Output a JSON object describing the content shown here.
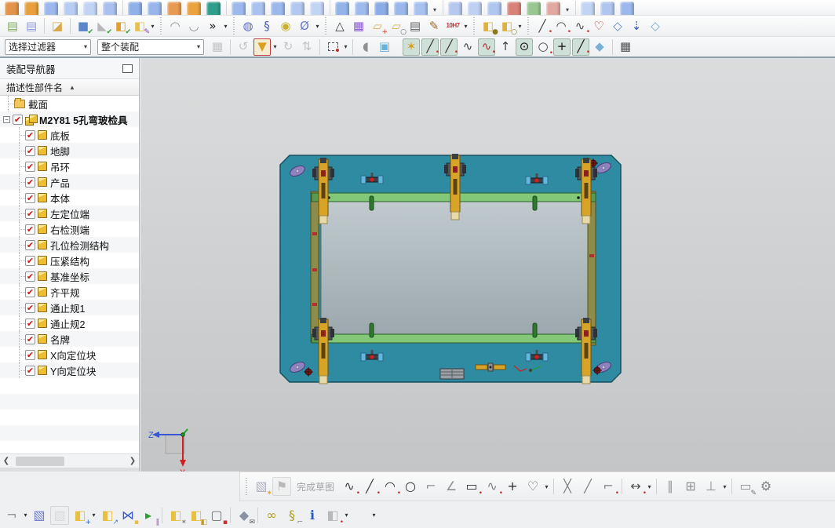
{
  "theme": {
    "plate": "#2f8ba2",
    "plate-dark": "#17505f",
    "glass-a": "#bcc6ca",
    "glass-b": "#9ca8ad",
    "bar": "#82c878",
    "bar-dark": "#2e5c2a",
    "rail": "#8e8c4a",
    "rail-dark": "#55521f",
    "clamp": "#d8a428",
    "clamp-dark": "#6b5210",
    "ring": "#8f82c0",
    "bluebit": "#62b8dc",
    "pin": "#2e7a2e",
    "axis-z": "#3858d0",
    "axis-x": "#d02020",
    "axis-y": "#20a020",
    "toggle-bg": "#cfe0d8"
  },
  "toolbars": {
    "row1": {
      "items": [
        {
          "c": "#e2944a"
        },
        {
          "c": "#e8a03c"
        },
        {
          "c": "#9db8ec"
        },
        {
          "c": "#b6ccf2"
        },
        {
          "c": "#c2d4f4"
        },
        {
          "c": "#aac0ee"
        },
        {
          "sep": true
        },
        {
          "c": "#8fb0e8"
        },
        {
          "c": "#98b6ec"
        },
        {
          "c": "#e89a50"
        },
        {
          "c": "#eca33e"
        },
        {
          "c": "#2f9e8a"
        },
        {
          "sep": true
        },
        {
          "c": "#9db8ec"
        },
        {
          "c": "#aac2f0"
        },
        {
          "c": "#9db8ec"
        },
        {
          "c": "#b2c8f0"
        },
        {
          "c": "#c2d4f4"
        },
        {
          "sep": true
        },
        {
          "c": "#92b4ea"
        },
        {
          "c": "#9ebbee"
        },
        {
          "c": "#8cace6"
        },
        {
          "c": "#9ab8ec"
        },
        {
          "c": "#a8c2f0"
        },
        {
          "dd": true
        },
        {
          "sep": true
        },
        {
          "c": "#b6c8f0"
        },
        {
          "c": "#c0d0f2"
        },
        {
          "c": "#aec6f0"
        },
        {
          "c": "#d8827a"
        },
        {
          "c": "#98c890"
        },
        {
          "c": "#e0a8a0"
        },
        {
          "dd": true
        },
        {
          "sep": true
        },
        {
          "c": "#c2d4f4"
        },
        {
          "c": "#b0c6f0"
        },
        {
          "c": "#9db8ec"
        }
      ]
    },
    "row2": {
      "items": [
        {
          "n": "layer-operations-icon",
          "g": "▤",
          "c": "#7fae5a"
        },
        {
          "n": "layer-settings-icon",
          "g": "▤",
          "c": "#8f9fd8"
        },
        {
          "sep": true
        },
        {
          "n": "part-tag-icon",
          "g": "◪",
          "c": "#d8a84a"
        },
        {
          "sep": true
        },
        {
          "n": "examine-geometry-icon",
          "g": "■",
          "c": "#5b86c8",
          "o": "✔",
          "oc": "#2e9e2e"
        },
        {
          "n": "verify-tool-icon",
          "g": "◣",
          "c": "#b8b8b8",
          "o": "✔",
          "oc": "#2e9e2e"
        },
        {
          "n": "verify-cube-icon",
          "g": "◧",
          "c": "#e0a030",
          "o": "✔",
          "oc": "#2e9e2e"
        },
        {
          "n": "part-names-icon",
          "g": "◧",
          "c": "#e8c04a",
          "o": "✎",
          "oc": "#8a3ab0",
          "dd": true
        },
        {
          "handle": true
        },
        {
          "n": "draft-analysis-icon",
          "g": "◠",
          "c": "#909090"
        },
        {
          "n": "face-analysis-icon",
          "g": "◡",
          "c": "#909090"
        },
        {
          "n": "toolbar-overflow-icon",
          "g": "»",
          "c": "#222",
          "dd": true
        },
        {
          "handle": true
        },
        {
          "n": "coil-icon",
          "g": "◍",
          "c": "#5a6ac8"
        },
        {
          "n": "spring-icon",
          "g": "§",
          "c": "#4a5ab8"
        },
        {
          "n": "washer-icon",
          "g": "◉",
          "c": "#c8b028"
        },
        {
          "n": "delete-spring-icon",
          "g": "Ø",
          "c": "#6a7ac8",
          "dd": true
        },
        {
          "handle": true
        },
        {
          "n": "triangle-mesh-icon",
          "g": "△",
          "c": "#404040"
        },
        {
          "n": "bom-table-icon",
          "g": "▦",
          "c": "#8a5ad0"
        },
        {
          "n": "points-folder-icon",
          "g": "▱",
          "c": "#d8b05a",
          "o": "+",
          "oc": "#d03030"
        },
        {
          "n": "holes-folder-icon",
          "g": "▱",
          "c": "#d8b05a",
          "o": "○",
          "oc": "#606060"
        },
        {
          "n": "notes-icon",
          "g": "▤",
          "c": "#606060"
        },
        {
          "n": "brush-icon",
          "g": "✎",
          "c": "#a06a30"
        },
        {
          "n": "tolerance-search-icon",
          "txt": "10H7",
          "c": "#c03030",
          "dd": true
        },
        {
          "handle": true
        },
        {
          "n": "lock-components-icon",
          "g": "◧",
          "c": "#e0b040",
          "o": "●",
          "oc": "#8a7a20"
        },
        {
          "n": "unlock-components-icon",
          "g": "◧",
          "c": "#e0b040",
          "o": "○",
          "oc": "#8a7a20",
          "dd": true
        },
        {
          "handle": true
        },
        {
          "n": "line-tool-icon",
          "g": "╱",
          "c": "#404040",
          "o": "•",
          "oc": "#d03030"
        },
        {
          "n": "arc-tool-icon",
          "g": "◠",
          "c": "#404040",
          "o": "•",
          "oc": "#d03030"
        },
        {
          "n": "studio-spline-icon",
          "g": "∿",
          "c": "#505050",
          "o": "•",
          "oc": "#d03030"
        },
        {
          "n": "closed-curve-icon",
          "g": "♡",
          "c": "#b03030"
        },
        {
          "n": "sheet-surface-icon",
          "g": "◇",
          "c": "#5a8ad0"
        },
        {
          "n": "project-curve-icon",
          "g": "⇣",
          "c": "#3858c0"
        },
        {
          "n": "swept-surface-icon",
          "g": "◇",
          "c": "#7aa2dc"
        }
      ]
    },
    "selection_bar": {
      "filter_combo": "选择过滤器",
      "scope_combo": "整个装配",
      "items": [
        {
          "n": "interpart-select-icon",
          "g": "▦",
          "c": "#888",
          "gray": true
        },
        {
          "sep": true
        },
        {
          "n": "previous-selection-icon",
          "g": "↺",
          "c": "#888",
          "gray": true
        },
        {
          "n": "selection-filter-icon",
          "g": "▼",
          "c": "#d8a020",
          "box": true,
          "dd": true
        },
        {
          "n": "reset-orientation-icon",
          "g": "↻",
          "c": "#888",
          "gray": true
        },
        {
          "n": "handles-icon",
          "g": "⇅",
          "c": "#888",
          "gray": true
        },
        {
          "sep": true
        },
        {
          "n": "marquee-select-icon",
          "dash": true,
          "dd": true
        },
        {
          "sep": true
        },
        {
          "n": "shaded-cap-icon",
          "g": "◖",
          "c": "#909090"
        },
        {
          "n": "section-view-icon",
          "g": "▣",
          "c": "#6ab0d8"
        },
        {
          "gap": true
        },
        {
          "n": "snap-enable-icon",
          "g": "✶",
          "c": "#d8a020",
          "on": true
        },
        {
          "n": "snap-endpoint-icon",
          "g": "╱",
          "c": "#303030",
          "o": "•",
          "oc": "#d03030",
          "on": true
        },
        {
          "n": "snap-midpoint-icon",
          "g": "╱",
          "c": "#303030",
          "o": "•",
          "oc": "#d03030",
          "on": true
        },
        {
          "n": "snap-tangent-icon",
          "g": "∿",
          "c": "#404040"
        },
        {
          "n": "snap-spline-pole-icon",
          "g": "∿",
          "c": "#b03030",
          "o": "•",
          "oc": "#b03030",
          "on": true
        },
        {
          "n": "snap-intersection-icon",
          "g": "↑",
          "c": "#404040"
        },
        {
          "n": "snap-arc-center-icon",
          "g": "⊙",
          "c": "#101010",
          "on": true
        },
        {
          "n": "snap-quadrant-icon",
          "g": "○",
          "c": "#404040",
          "o": "•",
          "oc": "#d03030"
        },
        {
          "n": "snap-point-icon",
          "g": "+",
          "c": "#101010",
          "on": true
        },
        {
          "n": "snap-existing-point-icon",
          "g": "╱",
          "c": "#101010",
          "o": "•",
          "oc": "#d03030",
          "on": true
        },
        {
          "n": "snap-point-on-face-icon",
          "g": "◆",
          "c": "#7ab0d8"
        },
        {
          "sep": true
        },
        {
          "n": "grid-snap-icon",
          "g": "▦",
          "c": "#505050"
        }
      ]
    },
    "sketch_bar": {
      "items": [
        {
          "handle": true
        },
        {
          "n": "sketch-in-task-icon",
          "g": "▧",
          "c": "#b0b0c0",
          "o": "✶",
          "oc": "#e8a020"
        },
        {
          "n": "finish-sketch-icon",
          "g": "⚑",
          "c": "#707070",
          "gray": true,
          "framed": true
        },
        {
          "label": "完成草图"
        },
        {
          "n": "profile-icon",
          "g": "∿",
          "c": "#404040",
          "o": "•",
          "oc": "#c03030"
        },
        {
          "n": "line-icon",
          "g": "╱",
          "c": "#404040",
          "o": "•",
          "oc": "#c03030"
        },
        {
          "n": "arc-icon",
          "g": "◠",
          "c": "#404040",
          "o": "•",
          "oc": "#c03030"
        },
        {
          "n": "circle-icon",
          "g": "○",
          "c": "#303030"
        },
        {
          "n": "fillet-icon",
          "g": "⌐",
          "c": "#909090"
        },
        {
          "n": "chamfer-icon",
          "g": "∠",
          "c": "#909090"
        },
        {
          "n": "rectangle-icon",
          "g": "▭",
          "c": "#303030",
          "o": "•",
          "oc": "#c03030"
        },
        {
          "n": "pattern-curve-icon",
          "g": "∿",
          "c": "#808080",
          "o": "•",
          "oc": "#c03030"
        },
        {
          "n": "point-icon",
          "g": "+",
          "c": "#303030"
        },
        {
          "n": "ellipse-conic-icon",
          "g": "♡",
          "c": "#606060",
          "dd": true
        },
        {
          "sep": true
        },
        {
          "n": "quick-trim-icon",
          "g": "╳",
          "c": "#808080"
        },
        {
          "n": "quick-extend-icon",
          "g": "╱",
          "c": "#808080"
        },
        {
          "n": "make-corner-icon",
          "g": "⌐",
          "c": "#808080",
          "o": "•",
          "oc": "#c03030"
        },
        {
          "sep": true
        },
        {
          "n": "rapid-dimension-icon",
          "g": "↔",
          "c": "#505050",
          "o": "•",
          "oc": "#c03030",
          "dd": true
        },
        {
          "sep": true
        },
        {
          "n": "parallel-constraint-icon",
          "g": "∥",
          "c": "#909090"
        },
        {
          "n": "geometric-constraints-icon",
          "g": "⊞",
          "c": "#909090"
        },
        {
          "n": "display-constraints-icon",
          "g": "⊥",
          "c": "#909090",
          "dd": true
        },
        {
          "sep": true
        },
        {
          "n": "edit-sketch-icon",
          "g": "▭",
          "c": "#909090",
          "o": "✎",
          "oc": "#707070"
        },
        {
          "n": "sketch-settings-icon",
          "g": "⚙",
          "c": "#808080"
        }
      ]
    },
    "assembly_bar": {
      "items": [
        {
          "n": "assembly-more-left",
          "g": "¬",
          "c": "#909090",
          "dd": true
        },
        {
          "n": "find-component-icon",
          "g": "▧",
          "c": "#6a7ad0"
        },
        {
          "n": "open-component-icon",
          "g": "▧",
          "c": "#c0c0c0",
          "gray": true,
          "framed": true
        },
        {
          "n": "add-component-icon",
          "g": "◧",
          "c": "#e8c040",
          "o": "+",
          "oc": "#2858d8",
          "dd": true
        },
        {
          "n": "move-component-icon",
          "g": "◧",
          "c": "#e8c040",
          "o": "↗",
          "oc": "#4878d8"
        },
        {
          "n": "mirror-assembly-icon",
          "g": "⋈",
          "c": "#3858c8",
          "o": "▪",
          "oc": "#e8c040"
        },
        {
          "n": "suppress-component-icon",
          "g": "▸",
          "c": "#2ea02e",
          "o": "∥",
          "oc": "#a040c0"
        },
        {
          "sep": true
        },
        {
          "n": "replace-component-icon",
          "g": "◧",
          "c": "#e8c040",
          "o": "✶",
          "oc": "#808080"
        },
        {
          "n": "assembly-constraints-icon",
          "g": "◧",
          "c": "#e8c040",
          "o": "◧",
          "oc": "#c89a20"
        },
        {
          "n": "component-sequence-icon",
          "g": "▢",
          "c": "#707070",
          "o": "▪",
          "oc": "#d03030"
        },
        {
          "sep": true
        },
        {
          "n": "wave-geometry-linker-icon",
          "g": "◆",
          "c": "#8a92a2",
          "o": "✉",
          "oc": "#606060"
        },
        {
          "sep": true
        },
        {
          "n": "interpart-link-icon",
          "g": "∞",
          "c": "#b0a020"
        },
        {
          "n": "remember-constraints-icon",
          "g": "§",
          "c": "#b0a020",
          "o": "⌐",
          "oc": "#808080"
        },
        {
          "n": "constraint-info-icon",
          "g": "ℹ",
          "c": "#2858c8"
        },
        {
          "n": "exploded-views-icon",
          "g": "◧",
          "c": "#b8b8b8",
          "o": "•",
          "oc": "#d03030",
          "dd": true
        },
        {
          "n": "assembly-more-right",
          "g": "",
          "c": "#303030",
          "dd": true
        }
      ]
    }
  },
  "navigator": {
    "title": "装配导航器",
    "column_header": "描述性部件名",
    "sort_indicator": "▲",
    "filler_rows": 6,
    "items": [
      {
        "label": "截面",
        "icon": "folder",
        "level": 1
      },
      {
        "label": "M2Y81 5孔弯玻检具",
        "icon": "assembly",
        "level": 1,
        "checked": true,
        "bold": true,
        "expander": "-"
      },
      {
        "label": "底板",
        "icon": "part",
        "level": 2,
        "checked": true
      },
      {
        "label": "地脚",
        "icon": "part",
        "level": 2,
        "checked": true
      },
      {
        "label": "吊环",
        "icon": "part",
        "level": 2,
        "checked": true
      },
      {
        "label": "产品",
        "icon": "part",
        "level": 2,
        "checked": true
      },
      {
        "label": "本体",
        "icon": "part",
        "level": 2,
        "checked": true
      },
      {
        "label": "左定位端",
        "icon": "part",
        "level": 2,
        "checked": true
      },
      {
        "label": "右检测端",
        "icon": "part",
        "level": 2,
        "checked": true
      },
      {
        "label": "孔位检测结构",
        "icon": "part",
        "level": 2,
        "checked": true
      },
      {
        "label": "压紧结构",
        "icon": "part",
        "level": 2,
        "checked": true
      },
      {
        "label": "基准坐标",
        "icon": "part",
        "level": 2,
        "checked": true
      },
      {
        "label": "齐平规",
        "icon": "part",
        "level": 2,
        "checked": true
      },
      {
        "label": "通止规1",
        "icon": "part",
        "level": 2,
        "checked": true
      },
      {
        "label": "通止规2",
        "icon": "part",
        "level": 2,
        "checked": true
      },
      {
        "label": "名牌",
        "icon": "part",
        "level": 2,
        "checked": true
      },
      {
        "label": "X向定位块",
        "icon": "part",
        "level": 2,
        "checked": true
      },
      {
        "label": "Y向定位块",
        "icon": "part",
        "level": 2,
        "checked": true
      }
    ]
  },
  "viewport": {
    "triad": {
      "z": "Z",
      "x": "X"
    },
    "model_name": "M2Y81 5孔弯玻检具"
  }
}
